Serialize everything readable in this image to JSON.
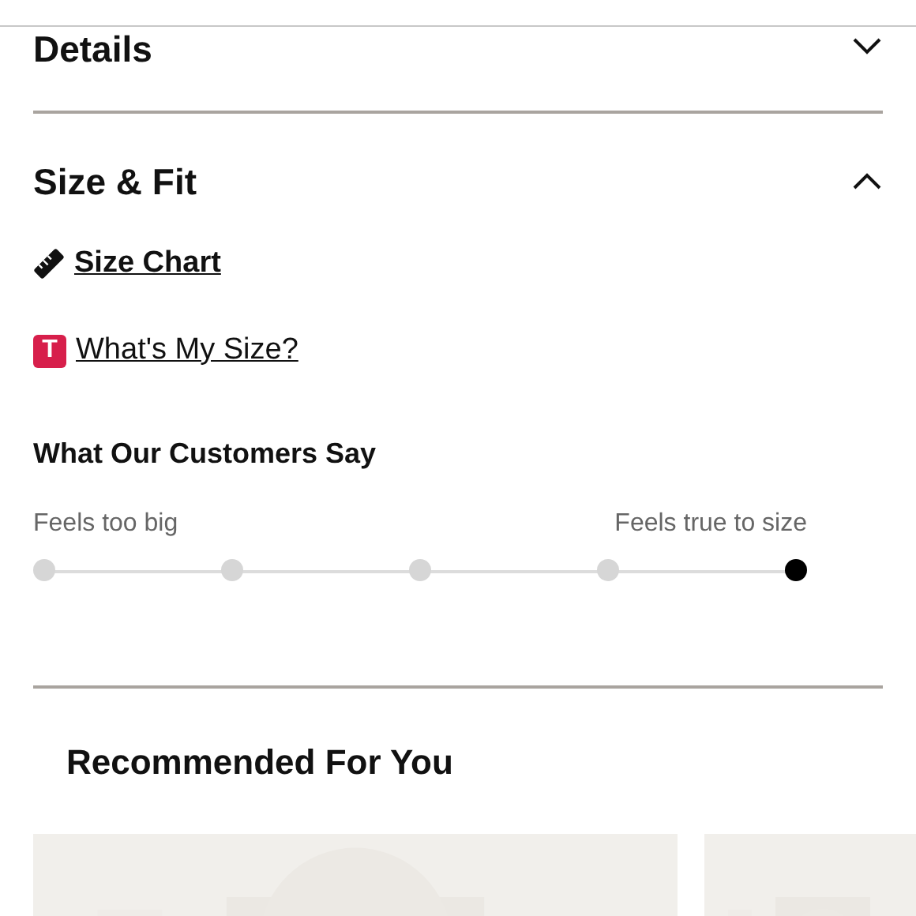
{
  "sections": [
    {
      "title": "Details",
      "expanded": false
    },
    {
      "title": "Size & Fit",
      "expanded": true
    }
  ],
  "links": [
    {
      "kind": "ruler",
      "label": "Size Chart"
    },
    {
      "kind": "badge",
      "badge": "T",
      "label": "What's My Size?"
    }
  ],
  "customers_say": {
    "title": "What Our Customers Say",
    "low_label": "Feels too big",
    "high_label": "Feels true to size",
    "points": [
      {
        "selected": false
      },
      {
        "selected": false
      },
      {
        "selected": false
      },
      {
        "selected": false
      },
      {
        "selected": true
      }
    ]
  },
  "recommended": {
    "title": "Recommended For You"
  }
}
